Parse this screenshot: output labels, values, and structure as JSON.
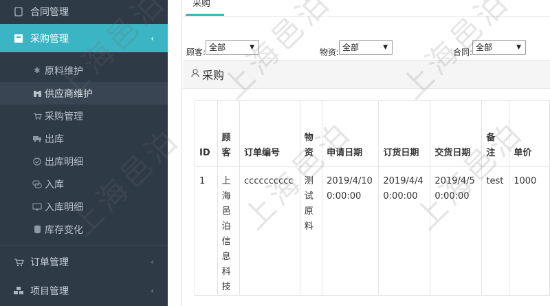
{
  "sidebar": {
    "top_item": {
      "label": "合同管理",
      "icon": "document-icon"
    },
    "active_item": {
      "label": "采购管理",
      "icon": "cart-box-icon",
      "chevron": "‹"
    },
    "sub_items": [
      {
        "label": "原料维护",
        "icon": "asterisk-icon"
      },
      {
        "label": "供应商维护",
        "icon": "binoculars-icon"
      },
      {
        "label": "采购管理",
        "icon": "cart-icon"
      },
      {
        "label": "出库",
        "icon": "truck-icon"
      },
      {
        "label": "出库明细",
        "icon": "check-circle-icon"
      },
      {
        "label": "入库",
        "icon": "chat-icon"
      },
      {
        "label": "入库明细",
        "icon": "monitor-icon"
      },
      {
        "label": "库存变化",
        "icon": "database-icon"
      }
    ],
    "bottom_items": [
      {
        "label": "订单管理",
        "icon": "cart-icon",
        "chevron": "‹"
      },
      {
        "label": "项目管理",
        "icon": "cubes-icon",
        "chevron": "‹"
      }
    ]
  },
  "tab": {
    "label": "采购"
  },
  "filters": [
    {
      "label": "顾客:",
      "value": "全部"
    },
    {
      "label": "物资:",
      "value": "全部"
    },
    {
      "label": "合同:",
      "value": "全部"
    }
  ],
  "panel": {
    "title": "采购"
  },
  "table": {
    "headers": [
      "ID",
      "顾客",
      "订单编号",
      "物资",
      "申请日期",
      "订货日期",
      "交货日期",
      "备注",
      "单价"
    ],
    "rows": [
      [
        "1",
        "上海邑泊信息科技",
        "cccccccccc",
        "测试原料",
        "2019/4/10 0:00:00",
        "2019/4/4 0:00:00",
        "2019/4/5 0:00:00",
        "test",
        "1000"
      ]
    ]
  },
  "watermark": "上海邑泊"
}
